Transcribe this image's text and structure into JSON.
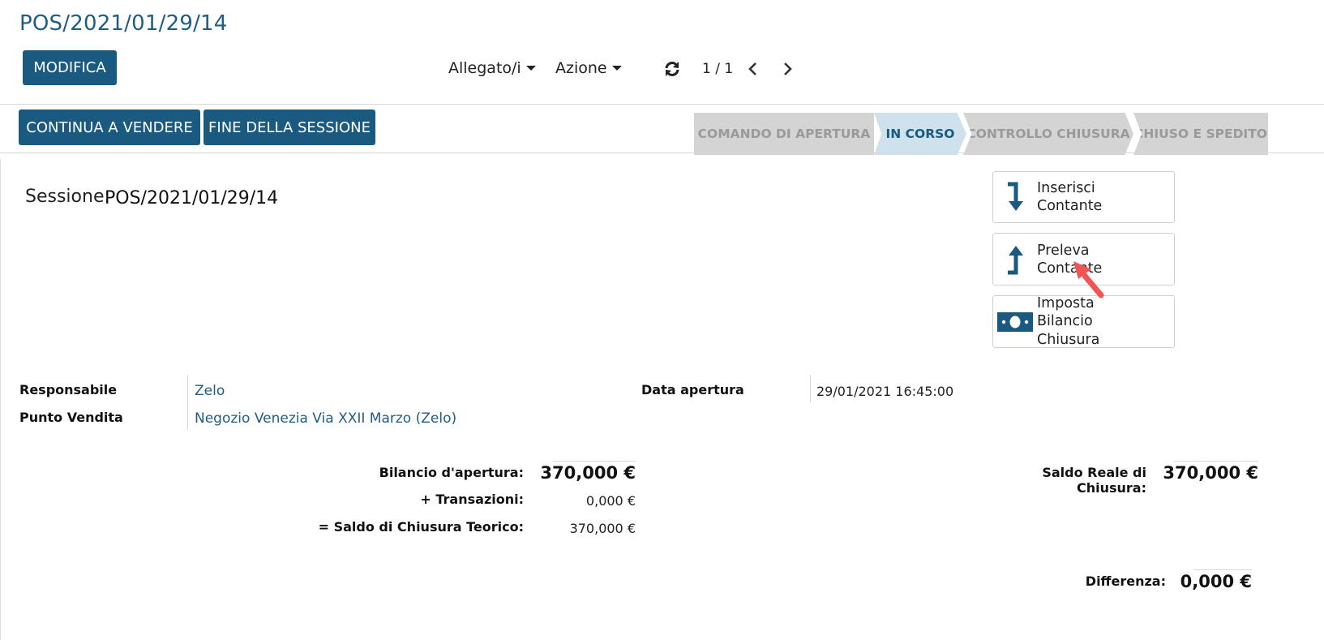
{
  "breadcrumb": "POS/2021/01/29/14",
  "control_panel": {
    "edit_label": "MODIFICA",
    "attachments_label": "Allegato/i",
    "action_label": "Azione",
    "pager_value": "1 / 1"
  },
  "header_buttons": {
    "continue_selling": "CONTINUA A VENDERE",
    "end_session": "FINE DELLA SESSIONE"
  },
  "statusbar": {
    "stages": [
      "COMANDO DI APERTURA",
      "IN CORSO",
      "CONTROLLO CHIUSURA",
      "CHIUSO E SPEDITO"
    ],
    "active_stage": "IN CORSO"
  },
  "smart_buttons": {
    "put_money_in": [
      "Inserisci",
      "Contante"
    ],
    "take_money_out": [
      "Preleva",
      "Contante"
    ],
    "set_closing_balance": [
      "Imposta",
      "Bilancio",
      "Chiusura"
    ]
  },
  "session": {
    "label": "Sessione:",
    "name": "POS/2021/01/29/14"
  },
  "fields": {
    "responsible_label": "Responsabile",
    "responsible_value": "Zelo",
    "pos_label": "Punto Vendita",
    "pos_value": "Negozio Venezia Via XXII Marzo (Zelo)",
    "opening_date_label": "Data apertura",
    "opening_date_value": "29/01/2021 16:45:00"
  },
  "balances": {
    "opening_label": "Bilancio d'apertura:",
    "opening_value": "370,000 €",
    "transactions_label": "+ Transazioni:",
    "transactions_value": "0,000 €",
    "theoretical_label": "= Saldo di Chiusura Teorico:",
    "theoretical_value": "370,000 €",
    "real_closing_label": "Saldo Reale di Chiusura:",
    "real_closing_value": "370,000 €",
    "difference_label": "Differenza:",
    "difference_value": "0,000 €"
  },
  "colors": {
    "primary": "#1a5a80",
    "link": "#1f5d85",
    "annotation_arrow": "#f05454"
  }
}
